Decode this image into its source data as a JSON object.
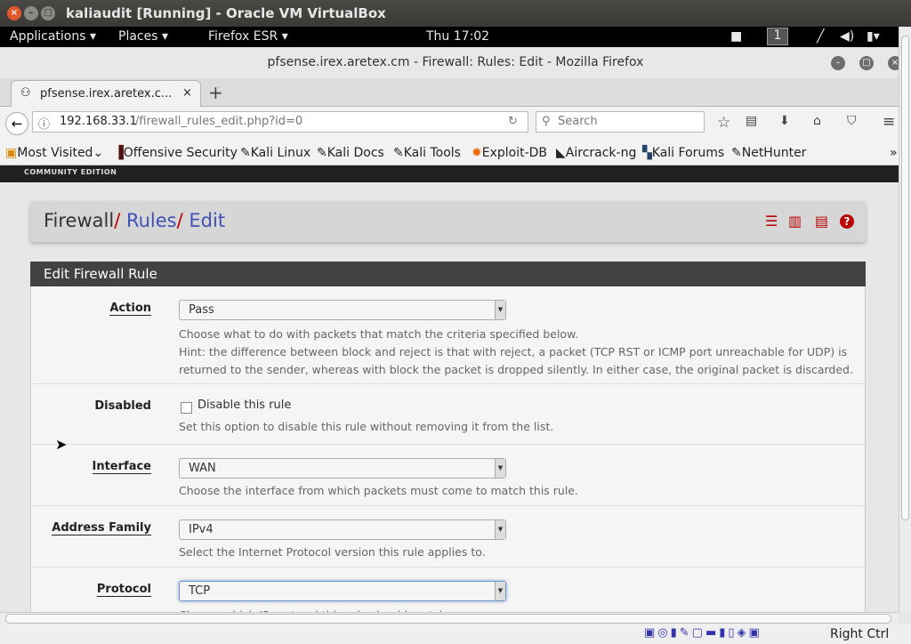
{
  "vbox": {
    "title": "kaliaudit [Running] - Oracle VM VirtualBox",
    "host_key": "Right Ctrl"
  },
  "gnome": {
    "applications": "Applications ▾",
    "places": "Places ▾",
    "firefox": "Firefox ESR ▾",
    "clock": "Thu 17:02",
    "workspace": "1"
  },
  "firefox": {
    "window_title": "pfsense.irex.aretex.cm - Firewall: Rules: Edit - Mozilla Firefox",
    "tab_title": "pfsense.irex.aretex.c...",
    "url_host": "192.168.33.1",
    "url_path": "/firewall_rules_edit.php?id=0",
    "search_placeholder": "Search",
    "bookmarks": [
      "Most Visited",
      "Offensive Security",
      "Kali Linux",
      "Kali Docs",
      "Kali Tools",
      "Exploit-DB",
      "Aircrack-ng",
      "Kali Forums",
      "NetHunter"
    ]
  },
  "pfsense": {
    "edition": "COMMUNITY EDITION",
    "breadcrumb": [
      "Firewall",
      "Rules",
      "Edit"
    ],
    "panel_title": "Edit Firewall Rule",
    "fields": {
      "action": {
        "label": "Action",
        "value": "Pass",
        "help": "Choose what to do with packets that match the criteria specified below.",
        "hint": "Hint: the difference between block and reject is that with reject, a packet (TCP RST or ICMP port unreachable for UDP) is returned to the sender, whereas with block the packet is dropped silently. In either case, the original packet is discarded."
      },
      "disabled": {
        "label": "Disabled",
        "checkbox": "Disable this rule",
        "checked": false,
        "help": "Set this option to disable this rule without removing it from the list."
      },
      "interface": {
        "label": "Interface",
        "value": "WAN",
        "help": "Choose the interface from which packets must come to match this rule."
      },
      "address_family": {
        "label": "Address Family",
        "value": "IPv4",
        "help": "Select the Internet Protocol version this rule applies to."
      },
      "protocol": {
        "label": "Protocol",
        "value": "TCP",
        "help": "Choose which IP protocol this rule should match."
      }
    },
    "accent": "#b71c1c",
    "link": "#3f51b5"
  }
}
